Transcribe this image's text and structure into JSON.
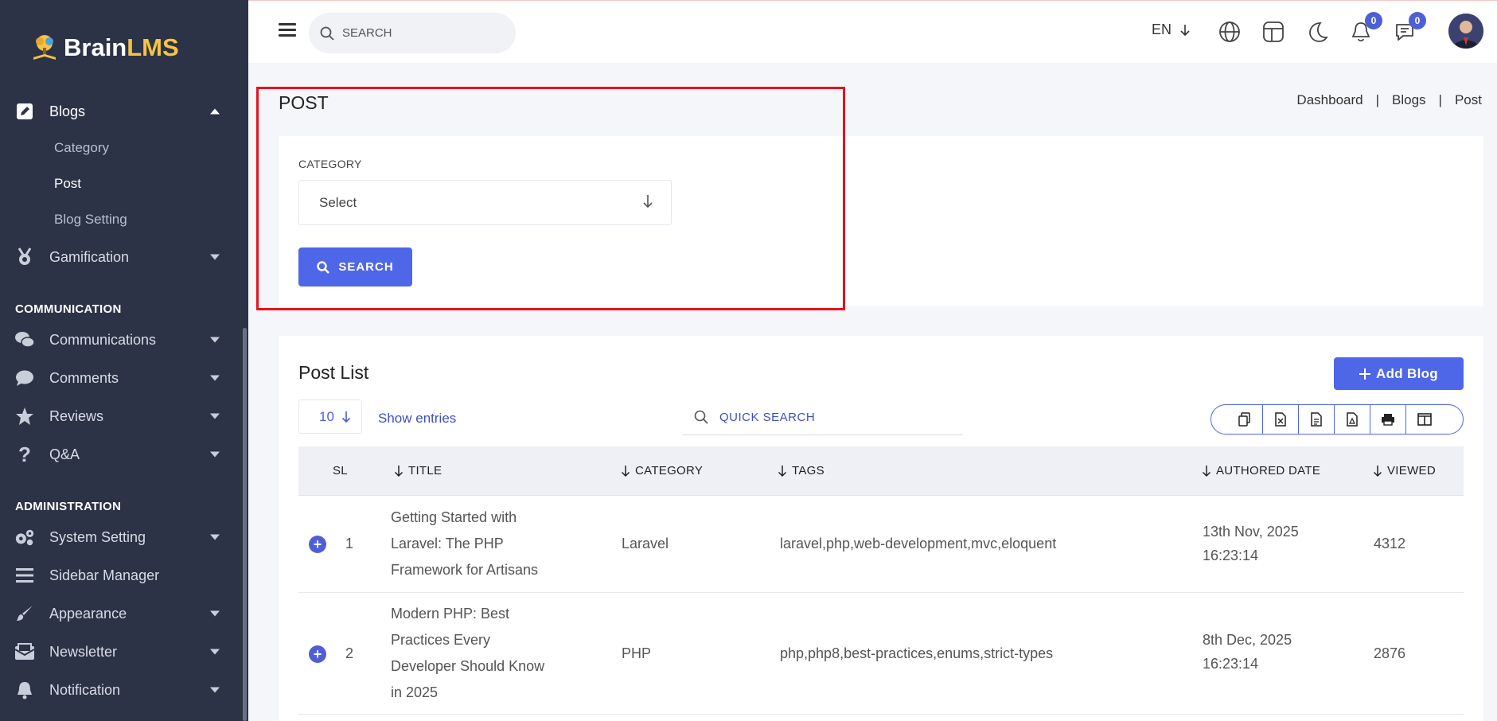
{
  "brand": {
    "part1": "Brain",
    "part2": "LMS"
  },
  "sidebar": {
    "items": [
      {
        "label": "Blogs",
        "icon": "edit-icon"
      },
      {
        "label": "Gamification",
        "icon": "medal-icon"
      },
      {
        "label": "Communications",
        "icon": "chat-icon"
      },
      {
        "label": "Comments",
        "icon": "comment-icon"
      },
      {
        "label": "Reviews",
        "icon": "star-icon"
      },
      {
        "label": "Q&A",
        "icon": "question-icon"
      },
      {
        "label": "System Setting",
        "icon": "gears-icon"
      },
      {
        "label": "Sidebar Manager",
        "icon": "bars-icon"
      },
      {
        "label": "Appearance",
        "icon": "brush-icon"
      },
      {
        "label": "Newsletter",
        "icon": "newsletter-icon"
      },
      {
        "label": "Notification",
        "icon": "bell-icon"
      }
    ],
    "sub_items": [
      "Category",
      "Post",
      "Blog Setting"
    ],
    "sections": {
      "communication": "COMMUNICATION",
      "administration": "ADMINISTRATION"
    }
  },
  "topbar": {
    "search_placeholder": "SEARCH",
    "language": "EN",
    "notifications_count": "0",
    "messages_count": "0"
  },
  "page": {
    "title": "POST",
    "breadcrumb": [
      "Dashboard",
      "|",
      "Blogs",
      "|",
      "Post"
    ]
  },
  "filter": {
    "category_label": "CATEGORY",
    "category_value": "Select",
    "search_label": "SEARCH"
  },
  "list": {
    "title": "Post List",
    "add_label": "Add Blog",
    "entries_value": "10",
    "entries_label": "Show entries",
    "quick_search_placeholder": "QUICK SEARCH",
    "columns": {
      "sl": "SL",
      "title": "TITLE",
      "category": "CATEGORY",
      "tags": "TAGS",
      "date": "AUTHORED DATE",
      "viewed": "VIEWED"
    },
    "rows": [
      {
        "sl": "1",
        "title_lines": [
          "Getting Started with",
          "Laravel: The PHP",
          "Framework for Artisans"
        ],
        "category": "Laravel",
        "tags": "laravel,php,web-development,mvc,eloquent",
        "date_lines": [
          "13th Nov, 2025",
          "16:23:14"
        ],
        "viewed": "4312"
      },
      {
        "sl": "2",
        "title_lines": [
          "Modern PHP: Best",
          "Practices Every",
          "Developer Should Know",
          "in 2025"
        ],
        "category": "PHP",
        "tags": "php,php8,best-practices,enums,strict-types",
        "date_lines": [
          "8th Dec, 2025",
          "16:23:14"
        ],
        "viewed": "2876"
      }
    ]
  },
  "colors": {
    "sidebar_bg": "#2d3346",
    "accent": "#4e66e8",
    "brand_yellow": "#f6c343",
    "highlight": "#e8121a"
  }
}
